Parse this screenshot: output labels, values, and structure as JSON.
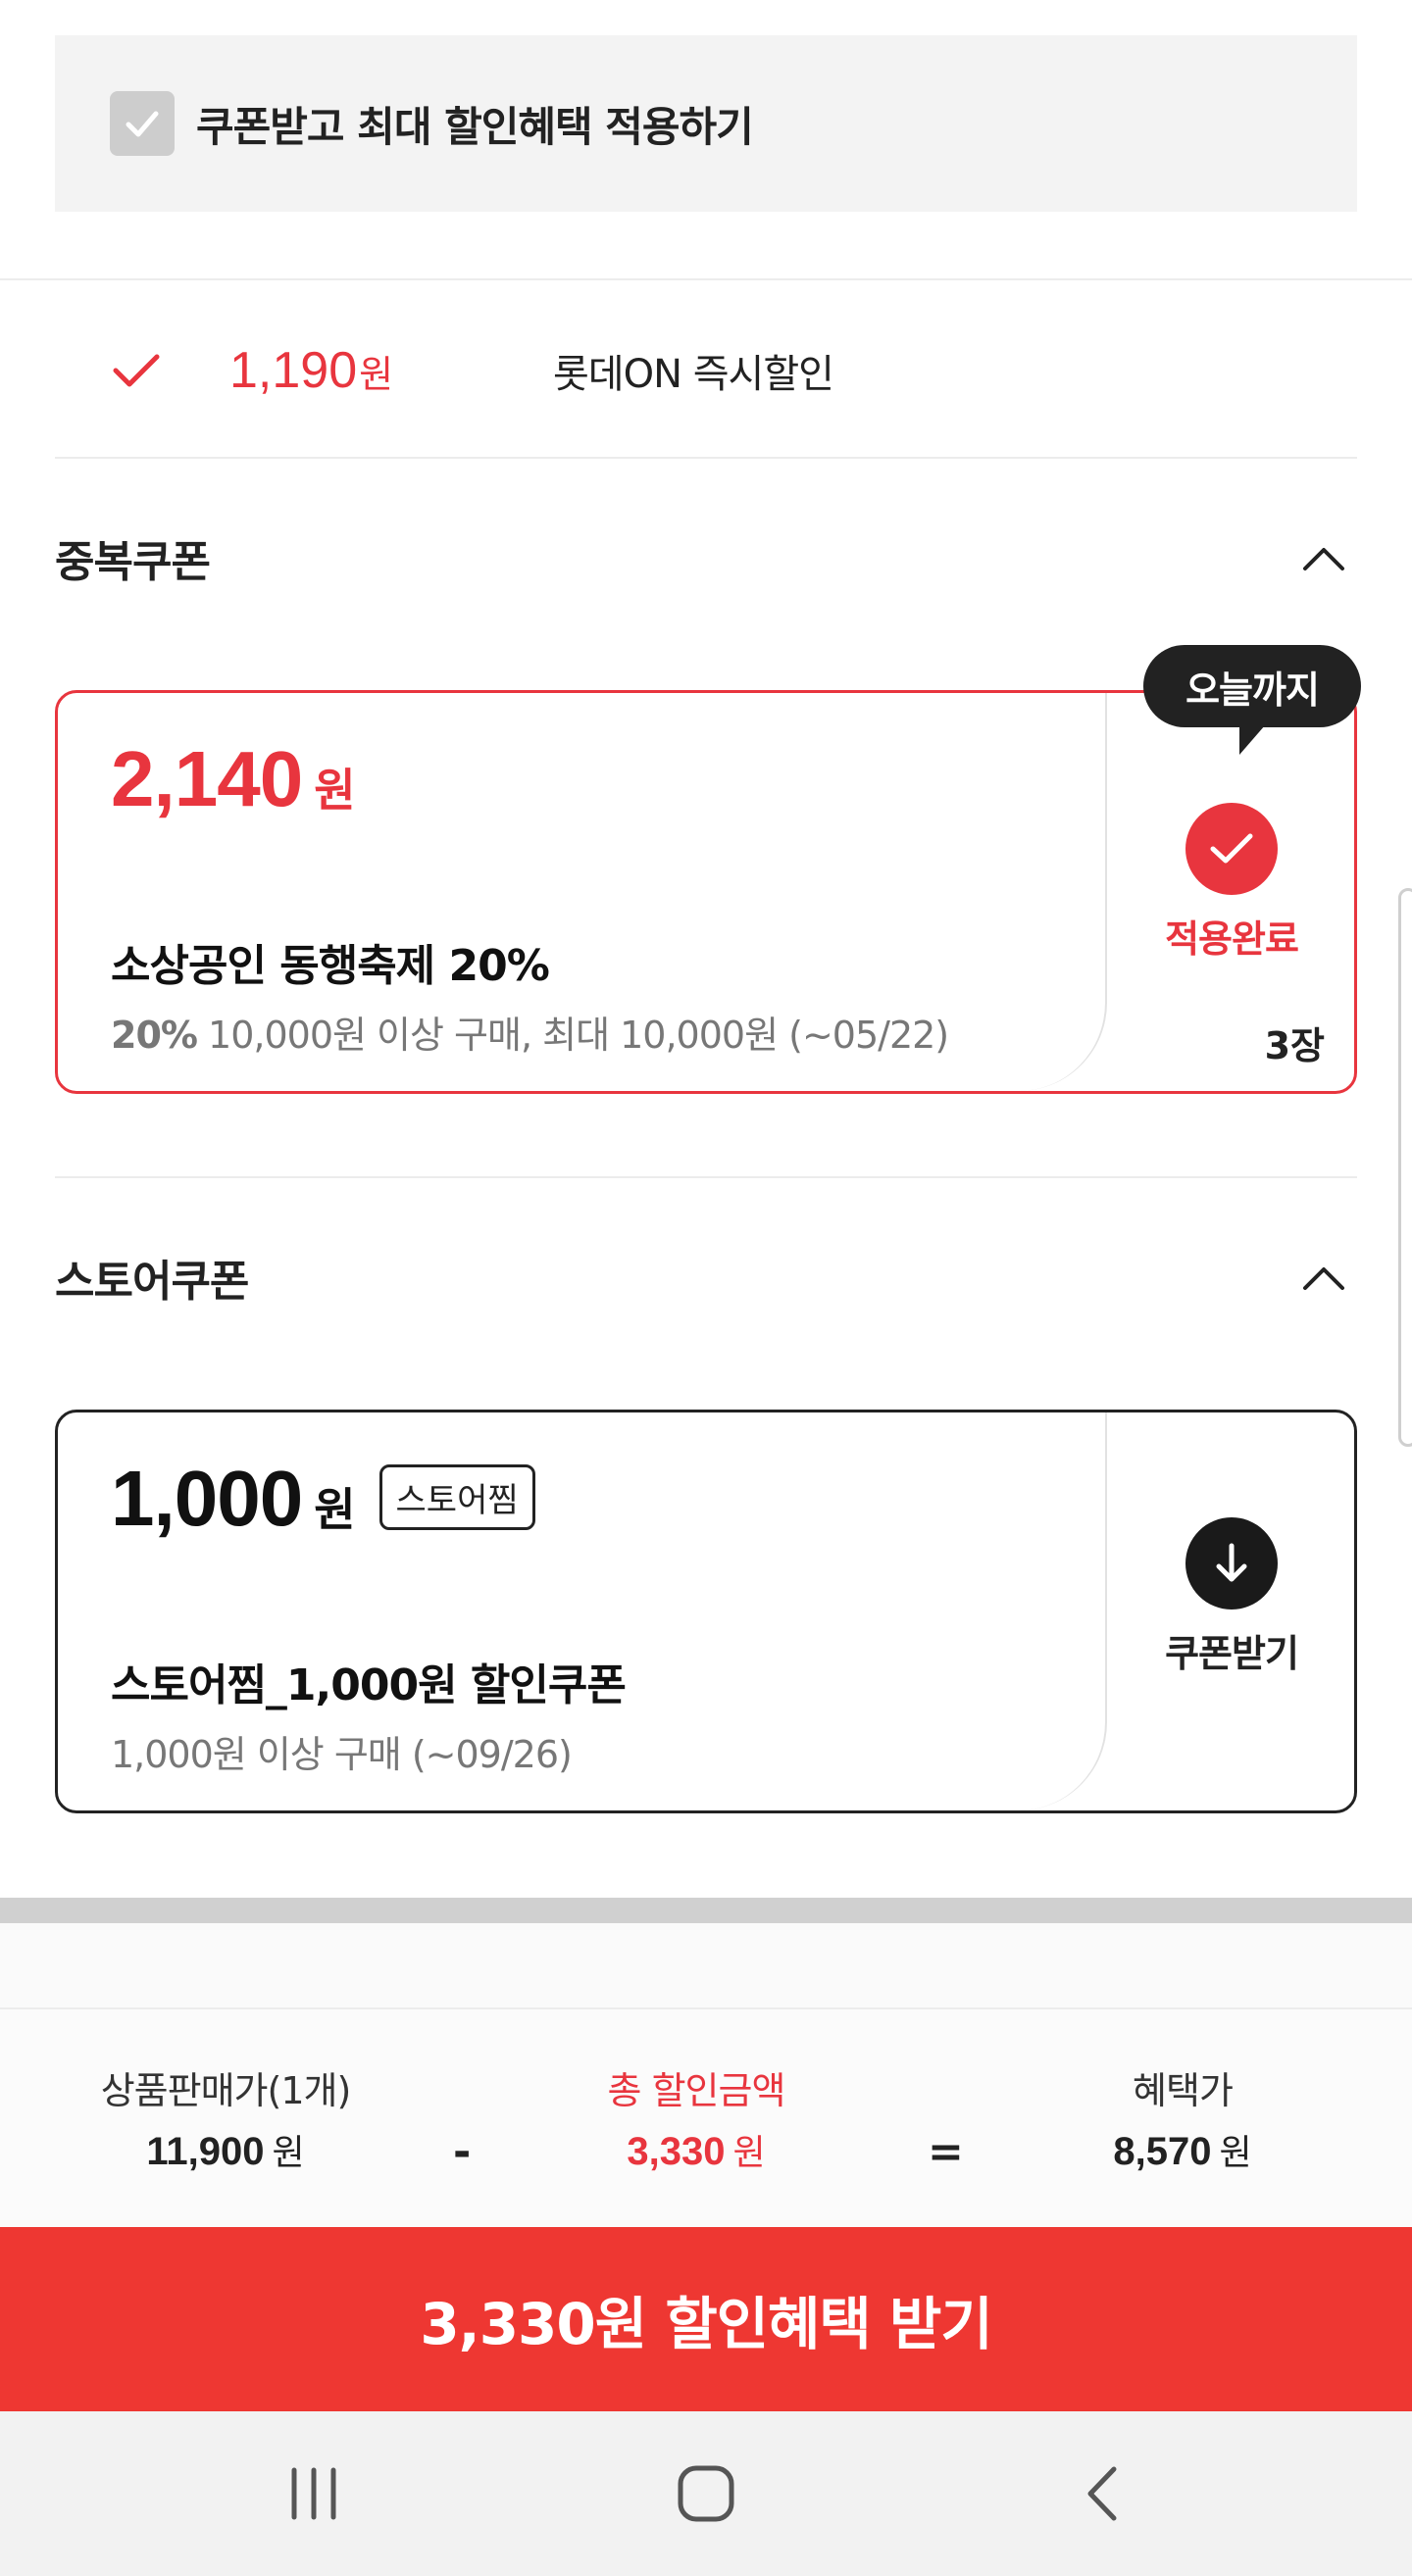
{
  "apply_max": {
    "label": "쿠폰받고 최대 할인혜택 적용하기",
    "checked": true
  },
  "instant_discount": {
    "amount": "1,190",
    "unit": "원",
    "name": "롯데ON 즉시할인"
  },
  "sections": {
    "duplicate": {
      "title": "중복쿠폰"
    },
    "store": {
      "title": "스토어쿠폰"
    }
  },
  "duplicate_coupon": {
    "tooltip": "오늘까지",
    "amount": "2,140",
    "unit": "원",
    "title": "소상공인 동행축제 20%",
    "desc_rate": "20%",
    "desc_rest": " 10,000원 이상 구매, 최대 10,000원  (~05/22)",
    "status_label": "적용완료",
    "count": "3장"
  },
  "store_coupon": {
    "amount": "1,000",
    "unit": "원",
    "badge": "스토어찜",
    "title": "스토어찜_1,000원 할인쿠폰",
    "desc": "1,000원 이상 구매  (~09/26)",
    "action_label": "쿠폰받기"
  },
  "summary": {
    "price_label": "상품판매가(1개)",
    "price_value": "11,900",
    "discount_label": "총 할인금액",
    "discount_value": "3,330",
    "final_label": "혜택가",
    "final_value": "8,570",
    "unit": "원",
    "minus": "-",
    "equals": "="
  },
  "cta": {
    "label": "3,330원 할인혜택 받기"
  },
  "colors": {
    "accent": "#e8353e",
    "cta": "#ee3732",
    "dark": "#222222"
  },
  "navbar": {
    "icons": [
      "recent-apps-icon",
      "home-icon",
      "back-icon"
    ]
  }
}
